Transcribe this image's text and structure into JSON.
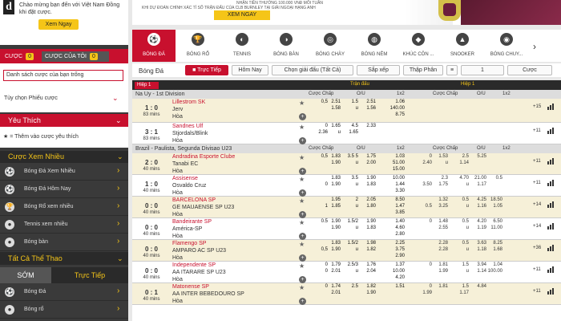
{
  "promo": {
    "logo": "d",
    "text": "Chào mừng bạn đến với Việt Nam Đồng khi đặt cược.",
    "button": "Xem Ngay"
  },
  "betslip": {
    "tab1": "CƯỢC",
    "tab1_count": "0",
    "tab2": "CƯỢC CỦA TÔI",
    "tab2_count": "0",
    "empty": "Danh sách cược của bạn trống",
    "options": "Tùy chọn Phiếu cược"
  },
  "favorites": {
    "title": "Yêu Thích",
    "hint": "= Thêm vào cược yêu thích"
  },
  "popular": {
    "title": "Cược Xem Nhiều",
    "items": [
      "Bóng Đá Xem Nhiều",
      "Bóng Đá Hôm Nay",
      "Bóng Rổ xem nhiều",
      "Tennis xem nhiều",
      "Bóng bàn"
    ]
  },
  "allsports": {
    "title": "Tất Cả Thể Thao",
    "early": "SỚM",
    "live": "Trực Tiếp",
    "items": [
      "Bóng Đá",
      "Bóng rổ"
    ]
  },
  "banner": {
    "line1": "NHẬN TIỀN THƯỞNG 100.000 VNĐ MỖI TUẦN",
    "line2": "KHI DỰ ĐOÁN CHÍNH XÁC TỈ SỐ TRẬN ĐẤU CỦA CLB BURNLEY TẠI GIẢI NGOẠI HẠNG ANH",
    "button": "XEM NGAY"
  },
  "sports": [
    "BÓNG ĐÁ",
    "BÓNG RỔ",
    "TENNIS",
    "BÓNG BÀN",
    "BÓNG CHÀY",
    "BÓNG NÉM",
    "KHÚC CÔN ...",
    "SNOOKER",
    "BÓNG CHUY..."
  ],
  "filters": {
    "title": "Bóng Đá",
    "live": "Trực Tiếp",
    "today": "Hôm Nay",
    "league": "Chọn giải đấu (Tất Cả)",
    "sort": "Sắp xếp",
    "odds": "Thập Phân",
    "eq": "=",
    "plus": "1",
    "ball": "Cược"
  },
  "table": {
    "half_tag": "Hiệp 1",
    "match_label": "Trận đấu",
    "half1_label": "Hiệp 1",
    "col_hcp": "Cược Chấp",
    "col_ou": "O/U",
    "col_1x2": "1x2",
    "leagues": [
      {
        "name": "Na Uy - 1st Division",
        "ch": ""
      },
      {
        "name": "Brazil - Paulista, Segunda Divisao U23",
        "ch": ""
      }
    ],
    "matches": [
      {
        "score": "1 : 0",
        "time": "83 mins",
        "home": "Lillestrom SK",
        "away": "Jerv",
        "draw": "Hòa",
        "o": [
          "0,5",
          "2.51",
          "1.5",
          "2.51",
          "1.06",
          "",
          "1.58",
          "u",
          "1.56",
          "140.00",
          "",
          "",
          "",
          "8.75"
        ],
        "h": [
          "",
          "",
          "",
          "",
          "",
          "",
          "",
          "",
          "",
          "",
          ""
        ],
        "more": "+15"
      },
      {
        "score": "3 : 1",
        "time": "83 mins",
        "home": "Sandnes Ulf",
        "away": "Stjordals/Blink",
        "draw": "Hòa",
        "o": [
          "0",
          "1.65",
          "4.5",
          "2.33",
          "",
          "2.36",
          "u",
          "1.65",
          "",
          "",
          "",
          "",
          ""
        ],
        "h": [],
        "more": "+11"
      },
      {
        "score": "2 : 0",
        "time": "40 mins",
        "home": "Andradina Esporte Clube",
        "away": "Tanabi EC",
        "draw": "Hòa",
        "o": [
          "0,5",
          "1.83",
          "3.5 5",
          "1.75",
          "1.03",
          "",
          "1.90",
          "u",
          "2.00",
          "51.00",
          "",
          "",
          "",
          "15.00"
        ],
        "h": [
          "0",
          "1.53",
          "2.5",
          "5.25",
          "",
          "2.40",
          "u",
          "1.14"
        ],
        "more": "+11"
      },
      {
        "score": "1 : 0",
        "time": "40 mins",
        "home": "Assisense",
        "away": "Osvaldo Cruz",
        "draw": "Hòa",
        "o": [
          "",
          "1.83",
          "3.5",
          "1.90",
          "10.00",
          "0",
          "1.90",
          "u",
          "1.83",
          "1.44",
          "",
          "",
          "",
          "3.30"
        ],
        "h": [
          "",
          "2.3",
          "4.70",
          "21.00",
          "0.5",
          "3.50",
          "1.75",
          "u",
          "1.17"
        ],
        "more": "+11"
      },
      {
        "score": "0 : 0",
        "time": "40 mins",
        "home": "BARCELONA SP",
        "away": "GE MAUAENSE SP U23",
        "draw": "Hòa",
        "o": [
          "",
          "1.95",
          "2",
          "2.05",
          "8.50",
          "1",
          "1.85",
          "u",
          "1.80",
          "1.47",
          "",
          "",
          "",
          "3.85"
        ],
        "h": [
          "",
          "1.32",
          "0.5",
          "4.25",
          "18.50",
          "0.5",
          "3.25",
          "u",
          "1.16",
          "1.05"
        ],
        "more": "+14"
      },
      {
        "score": "0 : 0",
        "time": "40 mins",
        "home": "Bandeirante SP",
        "away": "América-SP",
        "draw": "Hòa",
        "o": [
          "0.5",
          "1.90",
          "1.5/2",
          "1.90",
          "1.40",
          "",
          "1.90",
          "u",
          "1.83",
          "4.60",
          "",
          "",
          "",
          "2.80"
        ],
        "h": [
          "0",
          "1.48",
          "0.5",
          "4.20",
          "6.50",
          "",
          "2.55",
          "u",
          "1.19",
          "11.00"
        ],
        "more": "+14"
      },
      {
        "score": "0 : 0",
        "time": "40 mins",
        "home": "Flamengo SP",
        "away": "AMPARO AC SP U23",
        "draw": "Hòa",
        "o": [
          "",
          "1.83",
          "1.5/2",
          "1.98",
          "2.25",
          "0,5",
          "1.90",
          "u",
          "1.82",
          "3.75",
          "",
          "",
          "",
          "2.90"
        ],
        "h": [
          "",
          "2.28",
          "0.5",
          "3.63",
          "8.25",
          "",
          "2.28",
          "u",
          "1.18",
          "1.68"
        ],
        "more": "+36"
      },
      {
        "score": "0 : 0",
        "time": "40 mins",
        "home": "Independente SP",
        "away": "AA ITARARE SP U23",
        "draw": "Hòa",
        "o": [
          "0",
          "1.79",
          "2.5/3",
          "1.76",
          "1.37",
          "0",
          "2.01",
          "u",
          "2.04",
          "10.00",
          "",
          "",
          "",
          "4.20"
        ],
        "h": [
          "0",
          "1.81",
          "1.5",
          "3.94",
          "1.04",
          "",
          "1.99",
          "u",
          "1.14",
          "100.00"
        ],
        "more": "+11"
      },
      {
        "score": "0 : 1",
        "time": "40 mins",
        "home": "Matonense SP",
        "away": "AA INTER BEBEDOURO SP",
        "draw": "Hòa",
        "o": [
          "0",
          "1.74",
          "2.5",
          "1.82",
          "1.51",
          "",
          "2.01",
          "",
          "1.90",
          "",
          "",
          "",
          "",
          ""
        ],
        "h": [
          "0",
          "1.81",
          "1.5",
          "4.84",
          "",
          "1.99",
          "",
          "1.17"
        ],
        "more": "+11"
      }
    ]
  },
  "colors": {
    "brand_red": "#c8102e",
    "accent_yellow": "#f5c518",
    "dark": "#2a2a2a",
    "highlight_row": "#f6f0d8"
  }
}
